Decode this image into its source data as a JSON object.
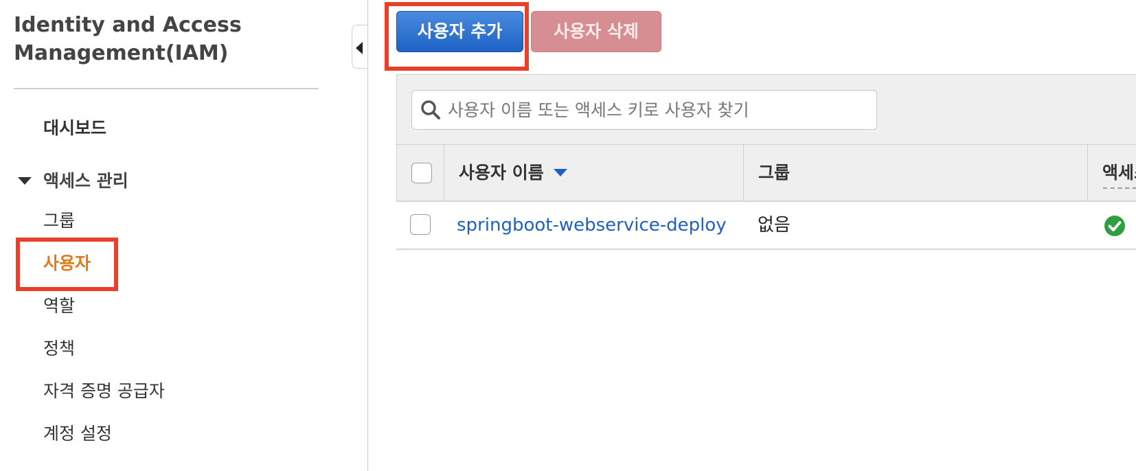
{
  "sidebar": {
    "app_title_line1": "Identity and Access",
    "app_title_line2": "Management(IAM)",
    "dashboard": "대시보드",
    "access_group_label": "액세스 관리",
    "items": [
      {
        "label": "그룹"
      },
      {
        "label": "사용자"
      },
      {
        "label": "역할"
      },
      {
        "label": "정책"
      },
      {
        "label": "자격 증명 공급자"
      },
      {
        "label": "계정 설정"
      }
    ]
  },
  "toolbar": {
    "add_user_label": "사용자 추가",
    "delete_user_label": "사용자 삭제"
  },
  "search": {
    "placeholder": "사용자 이름 또는 액세스 키로 사용자 찾기"
  },
  "table": {
    "columns": [
      "사용자 이름",
      "그룹",
      "액세스"
    ],
    "rows": [
      {
        "user_name": "springboot-webservice-deploy",
        "group": "없음",
        "status": "ok"
      }
    ]
  },
  "colors": {
    "primary": "#1d62c4",
    "danger": "#d78e92",
    "active_nav": "#e07b1b",
    "highlight": "#e8402a",
    "link": "#1f5fc1",
    "success": "#2e9e3e"
  },
  "icons": [
    "search-icon",
    "caret-down-icon",
    "collapse-left-icon",
    "sort-desc-icon",
    "check-circle-icon"
  ]
}
